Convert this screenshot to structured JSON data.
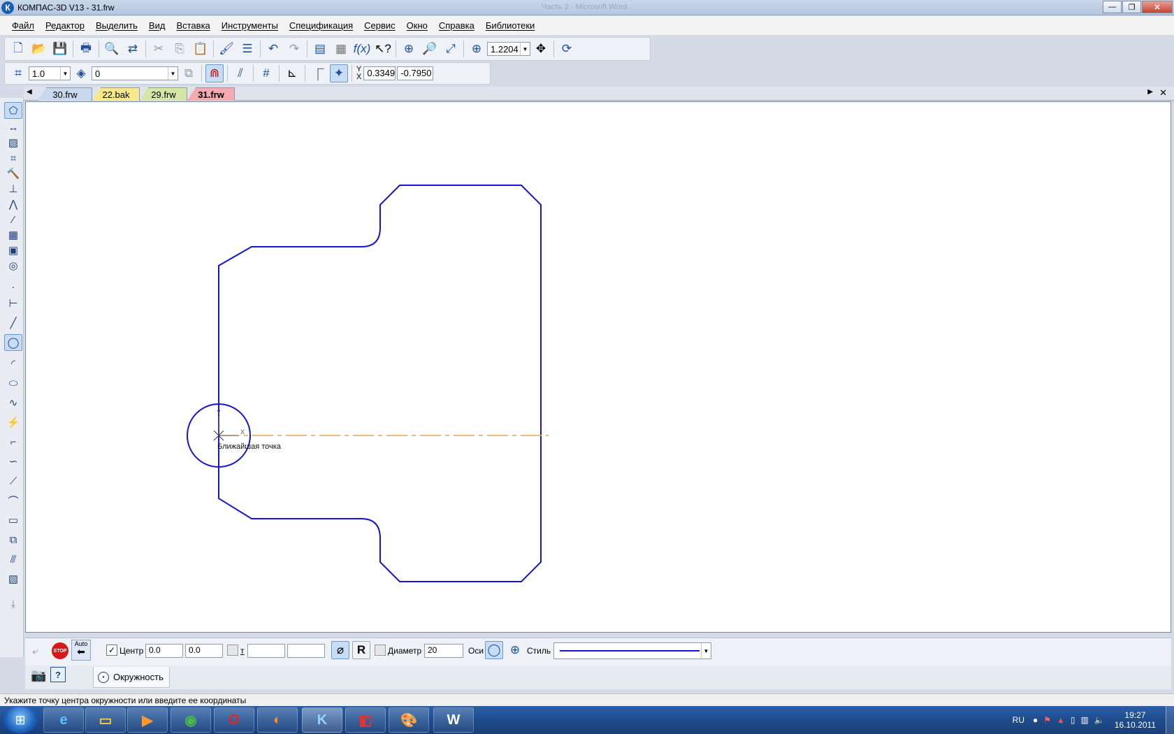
{
  "window": {
    "title": "КОМПАС-3D V13 - 31.frw",
    "logo": "К",
    "background_title": "Часть 2 - Microsoft Word"
  },
  "menu": [
    "Файл",
    "Редактор",
    "Выделить",
    "Вид",
    "Вставка",
    "Инструменты",
    "Спецификация",
    "Сервис",
    "Окно",
    "Справка",
    "Библиотеки"
  ],
  "toolbar1": {
    "zoom_value": "1.2204"
  },
  "toolbar2": {
    "step_value": "1.0",
    "layer_value": "0",
    "coord_y_label": "Y",
    "coord_x_label": "X",
    "coord_x_value": "0.3349",
    "coord_y_value": "-0.7950"
  },
  "tabs": [
    {
      "label": "30.frw",
      "color": "#c9d8ee"
    },
    {
      "label": "22.bak",
      "color": "#f7e98a"
    },
    {
      "label": "29.frw",
      "color": "#d5e6a6"
    },
    {
      "label": "31.frw",
      "color": "#f4aab0",
      "active": true
    }
  ],
  "canvas": {
    "tooltip": "Ближайшая точка",
    "outline_color": "#1414d2",
    "axis_color": "#f0a050",
    "cursor_x_label": "X",
    "cursor_y_label": "Y"
  },
  "properties": {
    "auto_label": "Auto",
    "stop_label": "STOP",
    "center_label": "Центр",
    "center_x": "0.0",
    "center_y": "0.0",
    "point_label": "т",
    "point_x": "",
    "point_y": "",
    "diameter_label": "Диаметр",
    "diameter_value": "20",
    "axes_label": "Оси",
    "style_label": "Стиль",
    "r_label": "R",
    "tab_label": "Окружность"
  },
  "status": "Укажите точку центра окружности или введите ее координаты",
  "tray": {
    "lang": "RU",
    "time": "19:27",
    "date": "16.10.2011"
  }
}
